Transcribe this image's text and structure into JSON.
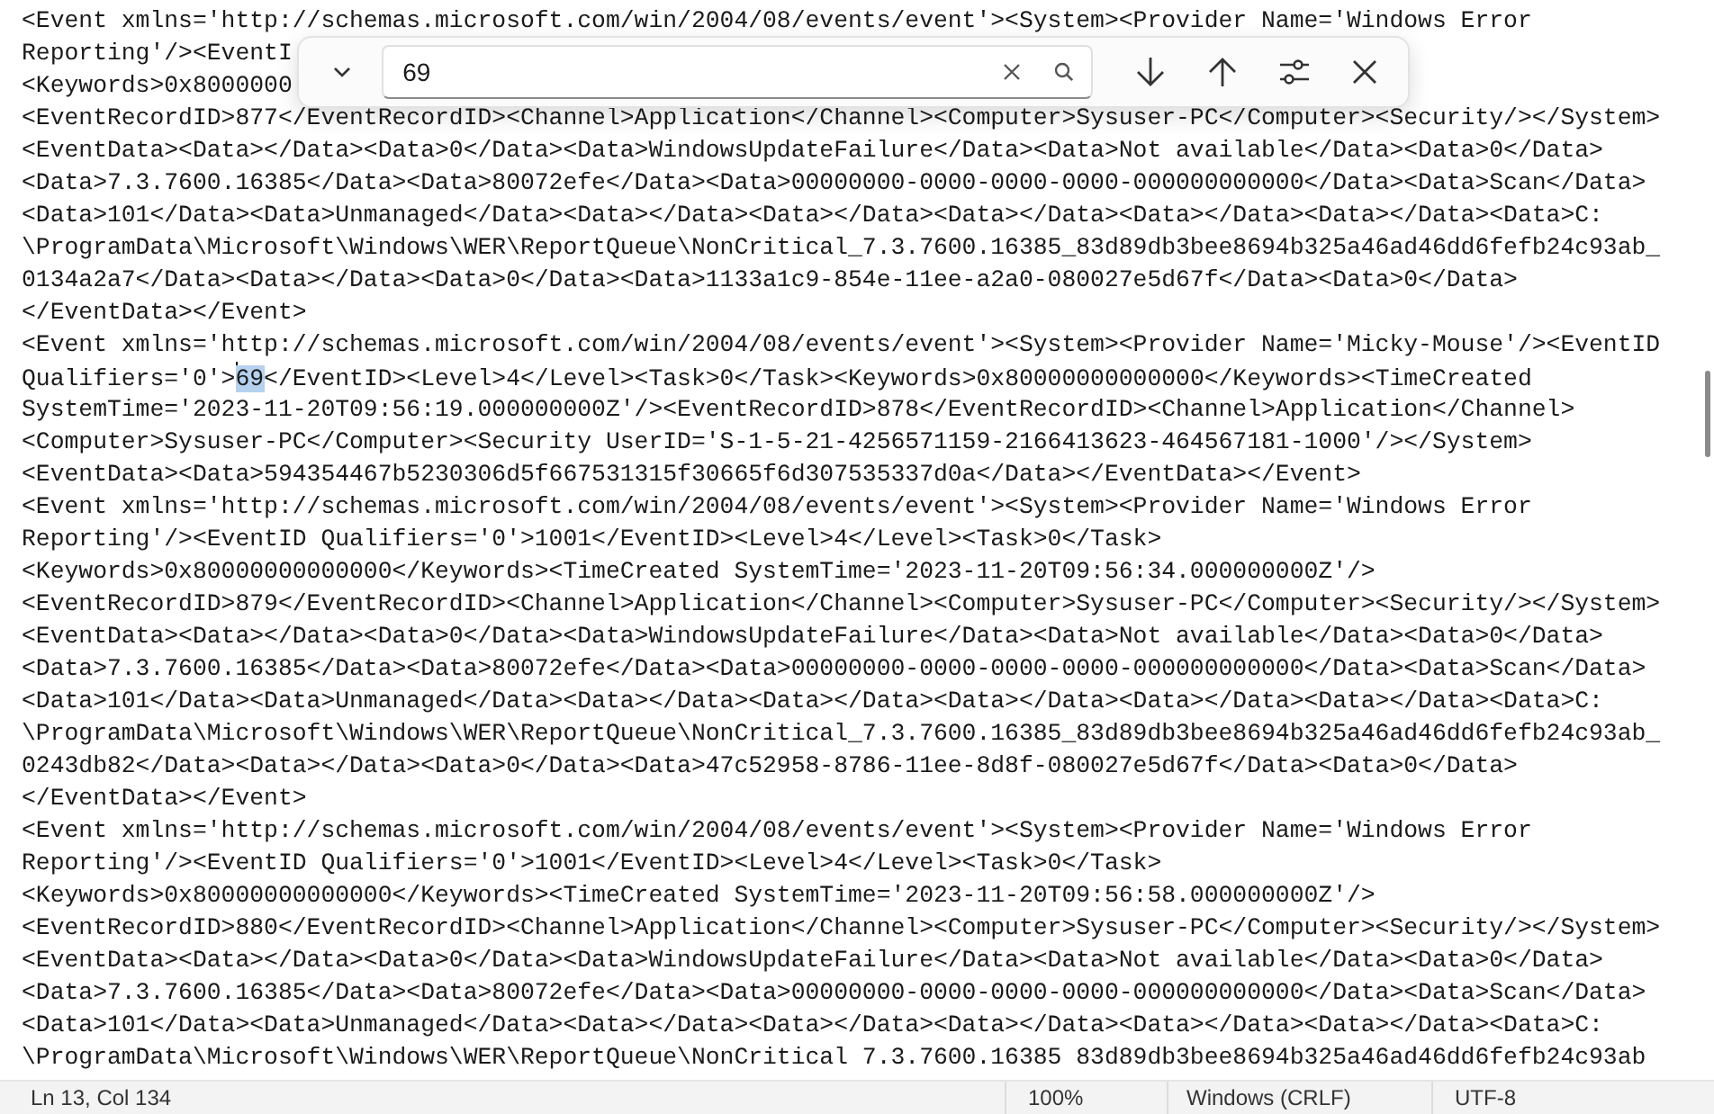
{
  "editor": {
    "lines": [
      [
        {
          "text": "<Event xmlns='http://schemas.microsoft.com/win/2004/08/events/event'><System><Provider Name='Windows Error",
          "highlighted": false
        }
      ],
      [
        {
          "text": "Reporting'/><EventI",
          "highlighted": false
        }
      ],
      [
        {
          "text": "<Keywords>0x8000000",
          "highlighted": false
        }
      ],
      [
        {
          "text": "<EventRecordID>877</EventRecordID><Channel>Application</Channel><Computer>Sysuser-PC</Computer><Security/></System>",
          "highlighted": false
        }
      ],
      [
        {
          "text": "<EventData><Data></Data><Data>0</Data><Data>WindowsUpdateFailure</Data><Data>Not available</Data><Data>0</Data>",
          "highlighted": false
        }
      ],
      [
        {
          "text": "<Data>7.3.7600.16385</Data><Data>80072efe</Data><Data>00000000-0000-0000-0000-000000000000</Data><Data>Scan</Data>",
          "highlighted": false
        }
      ],
      [
        {
          "text": "<Data>101</Data><Data>Unmanaged</Data><Data></Data><Data></Data><Data></Data><Data></Data><Data></Data><Data>C:",
          "highlighted": false
        }
      ],
      [
        {
          "text": "\\ProgramData\\Microsoft\\Windows\\WER\\ReportQueue\\NonCritical_7.3.7600.16385_83d89db3bee8694b325a46ad46dd6fefb24c93ab_",
          "highlighted": false
        }
      ],
      [
        {
          "text": "0134a2a7</Data><Data></Data><Data>0</Data><Data>1133a1c9-854e-11ee-a2a0-080027e5d67f</Data><Data>0</Data>",
          "highlighted": false
        }
      ],
      [
        {
          "text": "</EventData></Event>",
          "highlighted": false
        }
      ],
      [
        {
          "text": "<Event xmlns='http://schemas.microsoft.com/win/2004/08/events/event'><System><Provider Name='Micky-Mouse'/><EventID",
          "highlighted": false
        }
      ],
      [
        {
          "text": "Qualifiers='0'>",
          "highlighted": false
        },
        {
          "text": "69",
          "highlighted": true
        },
        {
          "text": "</EventID><Level>4</Level><Task>0</Task><Keywords>0x80000000000000</Keywords><TimeCreated",
          "highlighted": false
        }
      ],
      [
        {
          "text": "SystemTime='2023-11-20T09:56:19.000000000Z'/><EventRecordID>878</EventRecordID><Channel>Application</Channel>",
          "highlighted": false
        }
      ],
      [
        {
          "text": "<Computer>Sysuser-PC</Computer><Security UserID='S-1-5-21-4256571159-2166413623-464567181-1000'/></System>",
          "highlighted": false
        }
      ],
      [
        {
          "text": "<EventData><Data>594354467b5230306d5f667531315f30665f6d307535337d0a</Data></EventData></Event>",
          "highlighted": false
        }
      ],
      [
        {
          "text": "<Event xmlns='http://schemas.microsoft.com/win/2004/08/events/event'><System><Provider Name='Windows Error",
          "highlighted": false
        }
      ],
      [
        {
          "text": "Reporting'/><EventID Qualifiers='0'>1001</EventID><Level>4</Level><Task>0</Task>",
          "highlighted": false
        }
      ],
      [
        {
          "text": "<Keywords>0x80000000000000</Keywords><TimeCreated SystemTime='2023-11-20T09:56:34.000000000Z'/>",
          "highlighted": false
        }
      ],
      [
        {
          "text": "<EventRecordID>879</EventRecordID><Channel>Application</Channel><Computer>Sysuser-PC</Computer><Security/></System>",
          "highlighted": false
        }
      ],
      [
        {
          "text": "<EventData><Data></Data><Data>0</Data><Data>WindowsUpdateFailure</Data><Data>Not available</Data><Data>0</Data>",
          "highlighted": false
        }
      ],
      [
        {
          "text": "<Data>7.3.7600.16385</Data><Data>80072efe</Data><Data>00000000-0000-0000-0000-000000000000</Data><Data>Scan</Data>",
          "highlighted": false
        }
      ],
      [
        {
          "text": "<Data>101</Data><Data>Unmanaged</Data><Data></Data><Data></Data><Data></Data><Data></Data><Data></Data><Data>C:",
          "highlighted": false
        }
      ],
      [
        {
          "text": "\\ProgramData\\Microsoft\\Windows\\WER\\ReportQueue\\NonCritical_7.3.7600.16385_83d89db3bee8694b325a46ad46dd6fefb24c93ab_",
          "highlighted": false
        }
      ],
      [
        {
          "text": "0243db82</Data><Data></Data><Data>0</Data><Data>47c52958-8786-11ee-8d8f-080027e5d67f</Data><Data>0</Data>",
          "highlighted": false
        }
      ],
      [
        {
          "text": "</EventData></Event>",
          "highlighted": false
        }
      ],
      [
        {
          "text": "<Event xmlns='http://schemas.microsoft.com/win/2004/08/events/event'><System><Provider Name='Windows Error",
          "highlighted": false
        }
      ],
      [
        {
          "text": "Reporting'/><EventID Qualifiers='0'>1001</EventID><Level>4</Level><Task>0</Task>",
          "highlighted": false
        }
      ],
      [
        {
          "text": "<Keywords>0x80000000000000</Keywords><TimeCreated SystemTime='2023-11-20T09:56:58.000000000Z'/>",
          "highlighted": false
        }
      ],
      [
        {
          "text": "<EventRecordID>880</EventRecordID><Channel>Application</Channel><Computer>Sysuser-PC</Computer><Security/></System>",
          "highlighted": false
        }
      ],
      [
        {
          "text": "<EventData><Data></Data><Data>0</Data><Data>WindowsUpdateFailure</Data><Data>Not available</Data><Data>0</Data>",
          "highlighted": false
        }
      ],
      [
        {
          "text": "<Data>7.3.7600.16385</Data><Data>80072efe</Data><Data>00000000-0000-0000-0000-000000000000</Data><Data>Scan</Data>",
          "highlighted": false
        }
      ],
      [
        {
          "text": "<Data>101</Data><Data>Unmanaged</Data><Data></Data><Data></Data><Data></Data><Data></Data><Data></Data><Data>C:",
          "highlighted": false
        }
      ],
      [
        {
          "text": "\\ProgramData\\Microsoft\\Windows\\WER\\ReportQueue\\NonCritical 7.3.7600.16385 83d89db3bee8694b325a46ad46dd6fefb24c93ab",
          "highlighted": false
        }
      ]
    ]
  },
  "find_bar": {
    "query": "69"
  },
  "status_bar": {
    "position": "Ln 13, Col 134",
    "zoom": "100%",
    "line_ending": "Windows (CRLF)",
    "encoding": "UTF-8"
  }
}
